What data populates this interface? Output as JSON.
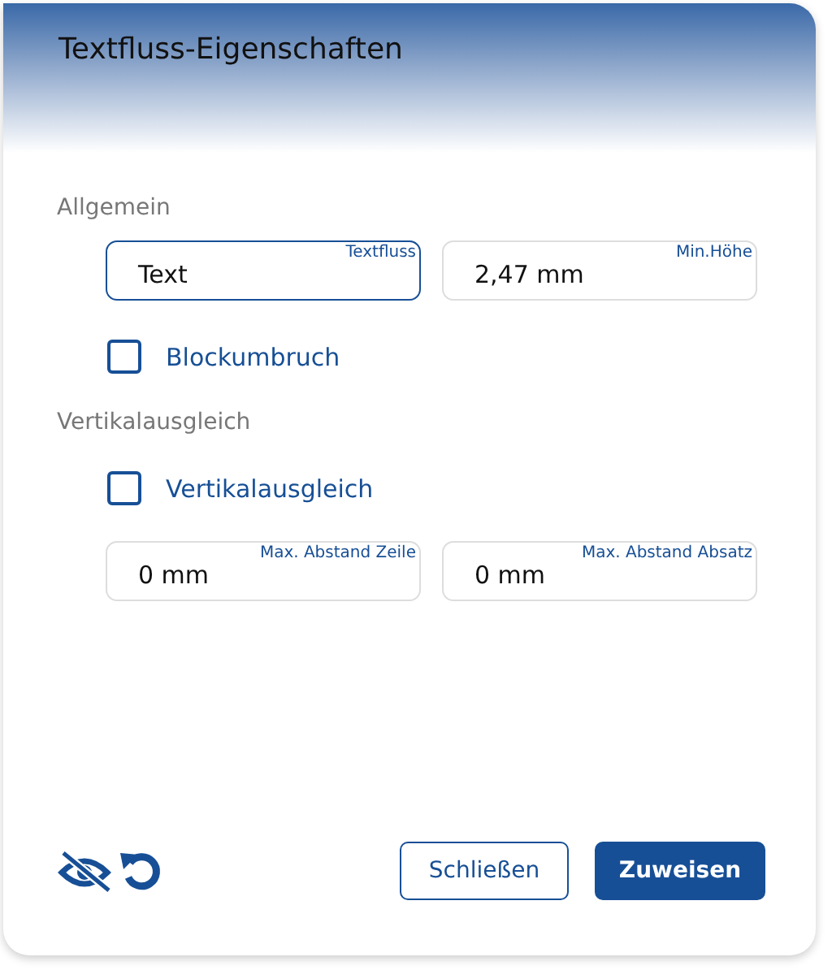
{
  "dialog": {
    "title": "Textfluss-Eigenschaften"
  },
  "sections": [
    {
      "heading": "Allgemein",
      "items": [
        {
          "kind": "fields",
          "fields": [
            {
              "label": "Textfluss",
              "value": "Text",
              "focused": true
            },
            {
              "label": "Min.Höhe",
              "value": "2,47 mm",
              "focused": false
            }
          ]
        },
        {
          "kind": "checkbox",
          "label": "Blockumbruch",
          "checked": false
        }
      ]
    },
    {
      "heading": "Vertikalausgleich",
      "items": [
        {
          "kind": "checkbox",
          "label": "Vertikalausgleich",
          "checked": false
        },
        {
          "kind": "fields",
          "fields": [
            {
              "label": "Max. Abstand Zeile",
              "value": "0 mm",
              "focused": false
            },
            {
              "label": "Max. Abstand Absatz",
              "value": "0 mm",
              "focused": false
            }
          ]
        }
      ]
    }
  ],
  "footer": {
    "buttons": [
      {
        "label": "Schließen",
        "kind": "secondary"
      },
      {
        "label": "Zuweisen",
        "kind": "primary"
      }
    ]
  }
}
